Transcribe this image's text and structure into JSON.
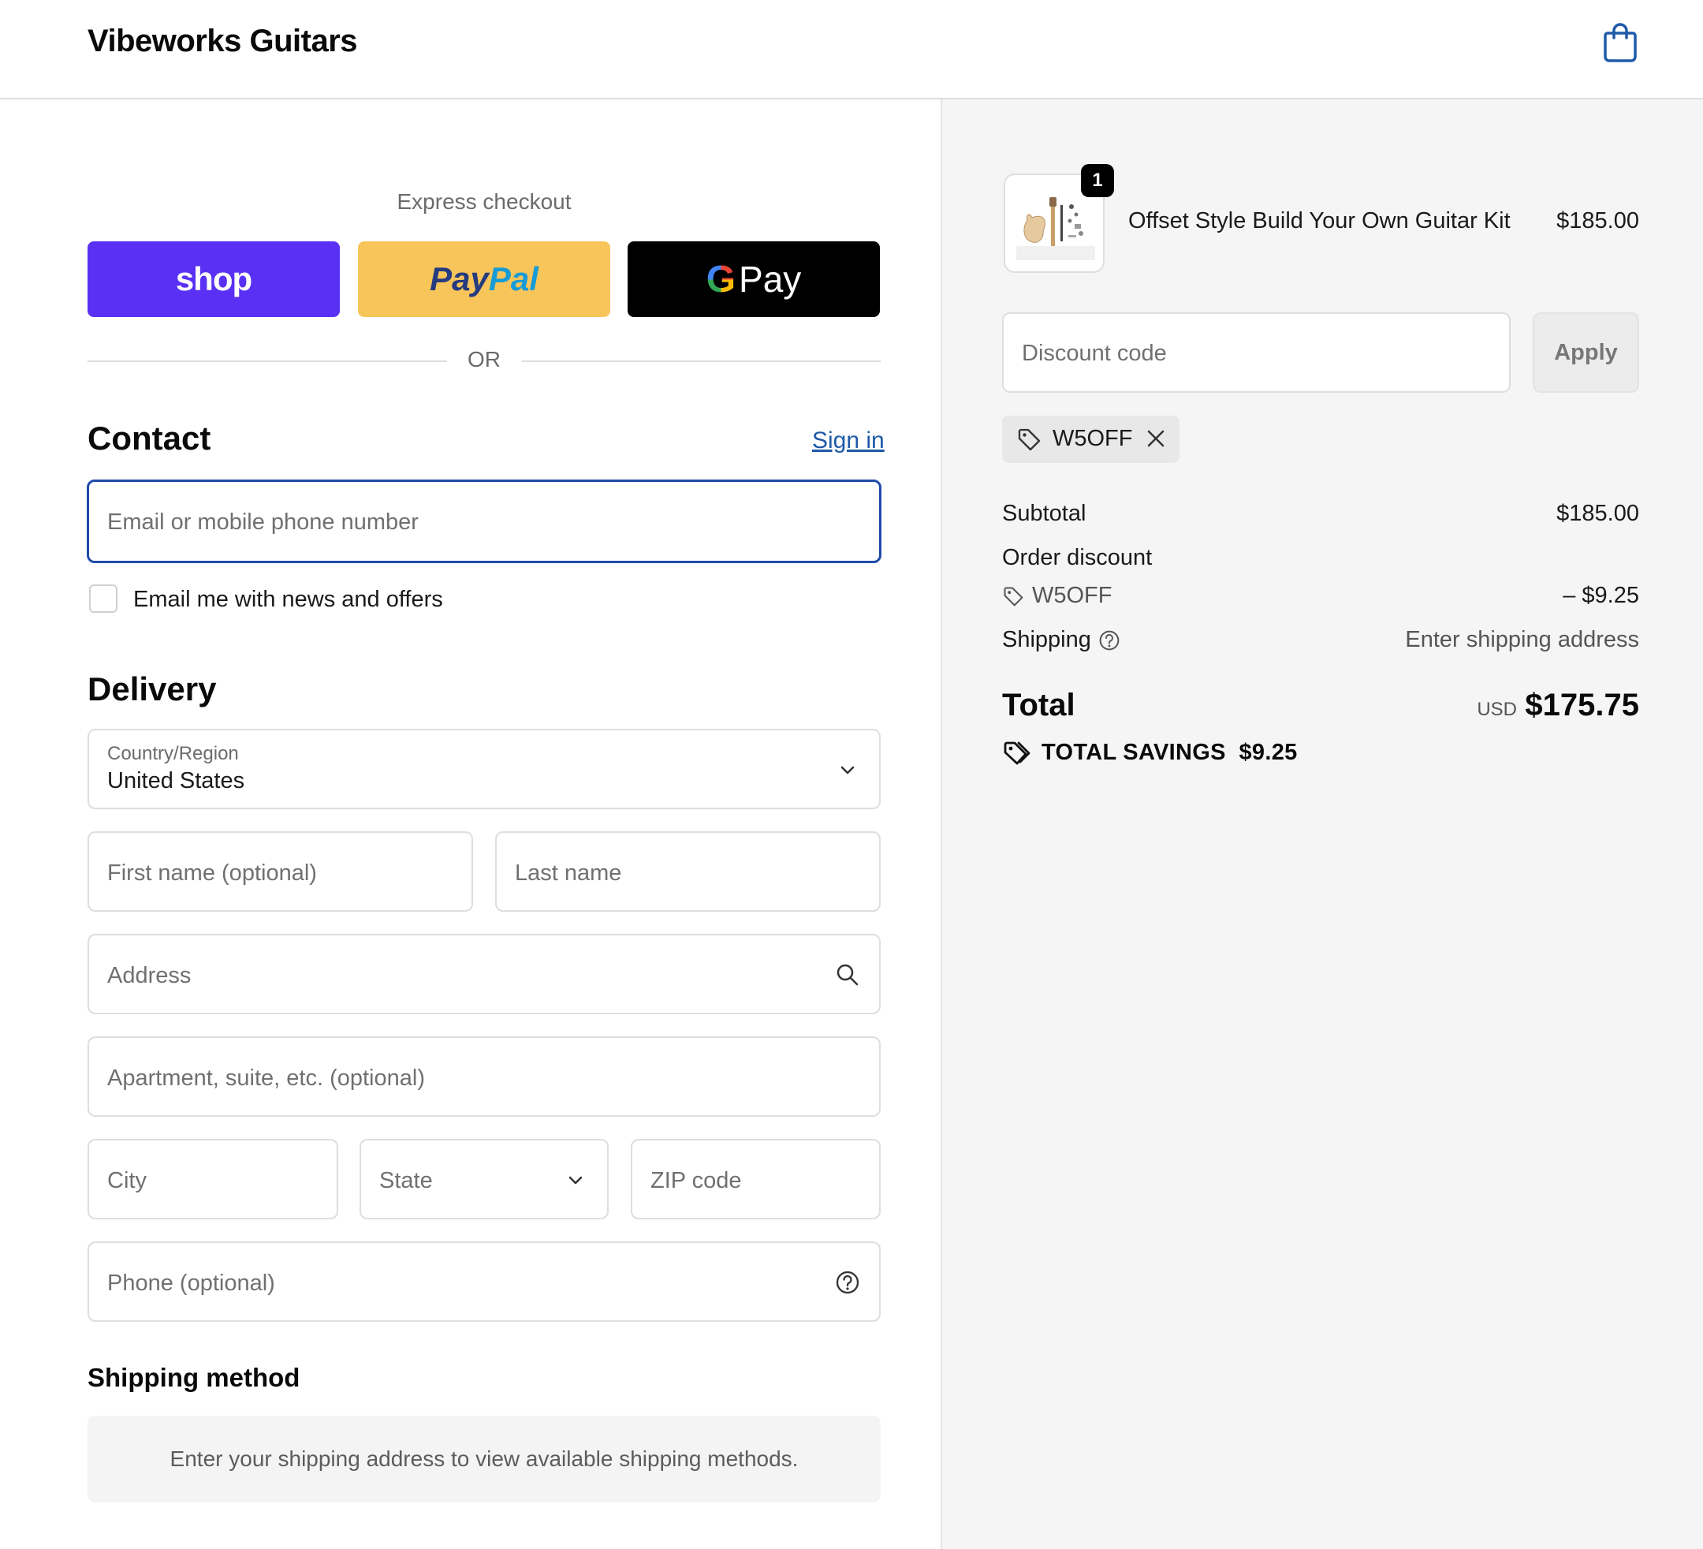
{
  "header": {
    "brand": "Vibeworks Guitars",
    "cart_icon": "shopping-bag-icon"
  },
  "express": {
    "label": "Express checkout",
    "buttons": {
      "shop": "shop",
      "paypal_a": "Pay",
      "paypal_b": "Pal",
      "gpay_g": "G",
      "gpay_text": "Pay"
    },
    "or_label": "OR"
  },
  "contact": {
    "title": "Contact",
    "sign_in": "Sign in",
    "email_placeholder": "Email or mobile phone number",
    "newsletter_label": "Email me with news and offers"
  },
  "delivery": {
    "title": "Delivery",
    "country_label": "Country/Region",
    "country_value": "United States",
    "first_name_placeholder": "First name (optional)",
    "last_name_placeholder": "Last name",
    "address_placeholder": "Address",
    "apartment_placeholder": "Apartment, suite, etc. (optional)",
    "city_placeholder": "City",
    "state_placeholder": "State",
    "zip_placeholder": "ZIP code",
    "phone_placeholder": "Phone (optional)"
  },
  "shipping_method": {
    "title": "Shipping method",
    "message": "Enter your shipping address to view available shipping methods."
  },
  "summary": {
    "item": {
      "quantity": "1",
      "name": "Offset Style Build Your Own Guitar Kit",
      "price": "$185.00"
    },
    "discount_placeholder": "Discount code",
    "apply_label": "Apply",
    "applied_code": "W5OFF",
    "subtotal_label": "Subtotal",
    "subtotal_value": "$185.00",
    "order_discount_label": "Order discount",
    "discount_code": "W5OFF",
    "discount_value": "– $9.25",
    "shipping_label": "Shipping",
    "shipping_value": "Enter shipping address",
    "total_label": "Total",
    "currency": "USD",
    "total_value": "$175.75",
    "savings_label": "TOTAL SAVINGS",
    "savings_value": "$9.25"
  },
  "colors": {
    "accent": "#1f4aa8",
    "shop_pay": "#5a31f4",
    "paypal": "#f7c55a",
    "gpay": "#000000",
    "summary_bg": "#f5f5f5"
  }
}
